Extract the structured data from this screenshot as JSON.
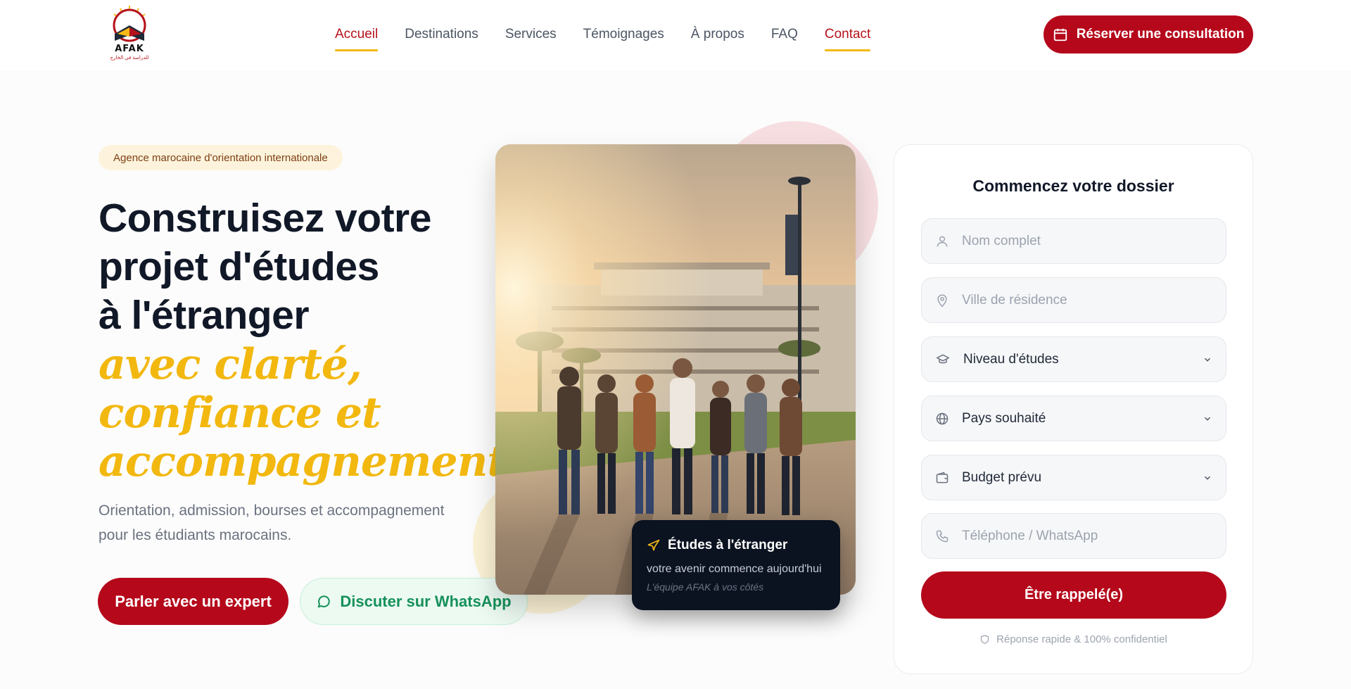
{
  "brand": {
    "name": "AFAK",
    "tagline_ar": "للدراسة في الخارج"
  },
  "nav": {
    "items": [
      {
        "label": "Accueil"
      },
      {
        "label": "Destinations"
      },
      {
        "label": "Services"
      },
      {
        "label": "Témoignages"
      },
      {
        "label": "À propos"
      },
      {
        "label": "FAQ"
      },
      {
        "label": "Contact"
      }
    ],
    "cta_label": "Réserver une consultation"
  },
  "hero": {
    "badge": "Agence marocaine d'orientation internationale",
    "headline_line1": "Construisez votre",
    "headline_line2": "projet d'études",
    "headline_line3": "à l'étranger",
    "accent_line1": "avec clarté,",
    "accent_line2": "confiance et",
    "accent_line3": "accompagnement.",
    "subtitle_line1": "Orientation, admission, bourses et accompagnement",
    "subtitle_line2": "pour les étudiants marocains.",
    "primary_button": "Parler avec un expert",
    "whatsapp_button": "Discuter sur WhatsApp"
  },
  "photo_card": {
    "title": "Études à l'étranger",
    "line": "votre avenir commence aujourd'hui",
    "signature": "L'équipe AFAK à vos côtés"
  },
  "form": {
    "title": "Commencez votre dossier",
    "name_placeholder": "Nom complet",
    "city_placeholder": "Ville de résidence",
    "level_select": "Niveau d'études",
    "country_select": "Pays souhaité",
    "budget_select": "Budget prévu",
    "phone_placeholder": "Téléphone / WhatsApp",
    "submit_label": "Être rappelé(e)",
    "note": "Réponse rapide & 100% confidentiel"
  },
  "colors": {
    "primary": "#b5081b",
    "accent": "#f2b80f",
    "whatsapp": "#16915a",
    "dark": "#0b1220"
  },
  "icons": {
    "cta_top": "calendar-icon",
    "whatsapp": "chat-bubble-icon",
    "caption": "airplane-icon",
    "name": "user-icon",
    "city": "map-pin-icon",
    "level": "graduation-cap-icon",
    "country": "globe-icon",
    "budget": "wallet-icon",
    "phone": "phone-icon",
    "note": "shield-icon"
  }
}
